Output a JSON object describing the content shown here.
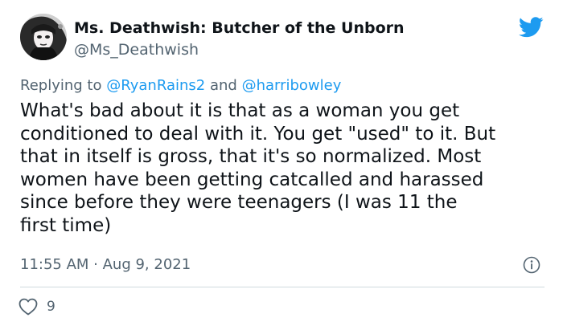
{
  "author": {
    "display_name": "Ms. Deathwish: Butcher of the Unborn",
    "handle": "@Ms_Deathwish",
    "avatar_icon": "profile-photo"
  },
  "reply": {
    "prefix": "Replying to",
    "mentions": [
      "@RyanRains2",
      "@harribowley"
    ],
    "conjunction": "and"
  },
  "tweet": {
    "lines": [
      "What's bad about it is that as a woman you get",
      "conditioned to deal with it. You get \"used\" to it. But",
      "that in itself is gross, that it's so normalized. Most",
      "women have been getting catcalled and harassed",
      "since before they were teenagers (I was 11 the",
      "first time)"
    ],
    "timestamp": "11:55 AM · Aug 9, 2021"
  },
  "engagement": {
    "likes": "9"
  },
  "colors": {
    "twitter_blue": "#1d9bf0",
    "text_primary": "#0f1419",
    "text_secondary": "#536471",
    "divider": "#cfd9de"
  },
  "icons": {
    "logo": "twitter-bird-icon",
    "info": "info-icon",
    "like": "heart-icon"
  }
}
